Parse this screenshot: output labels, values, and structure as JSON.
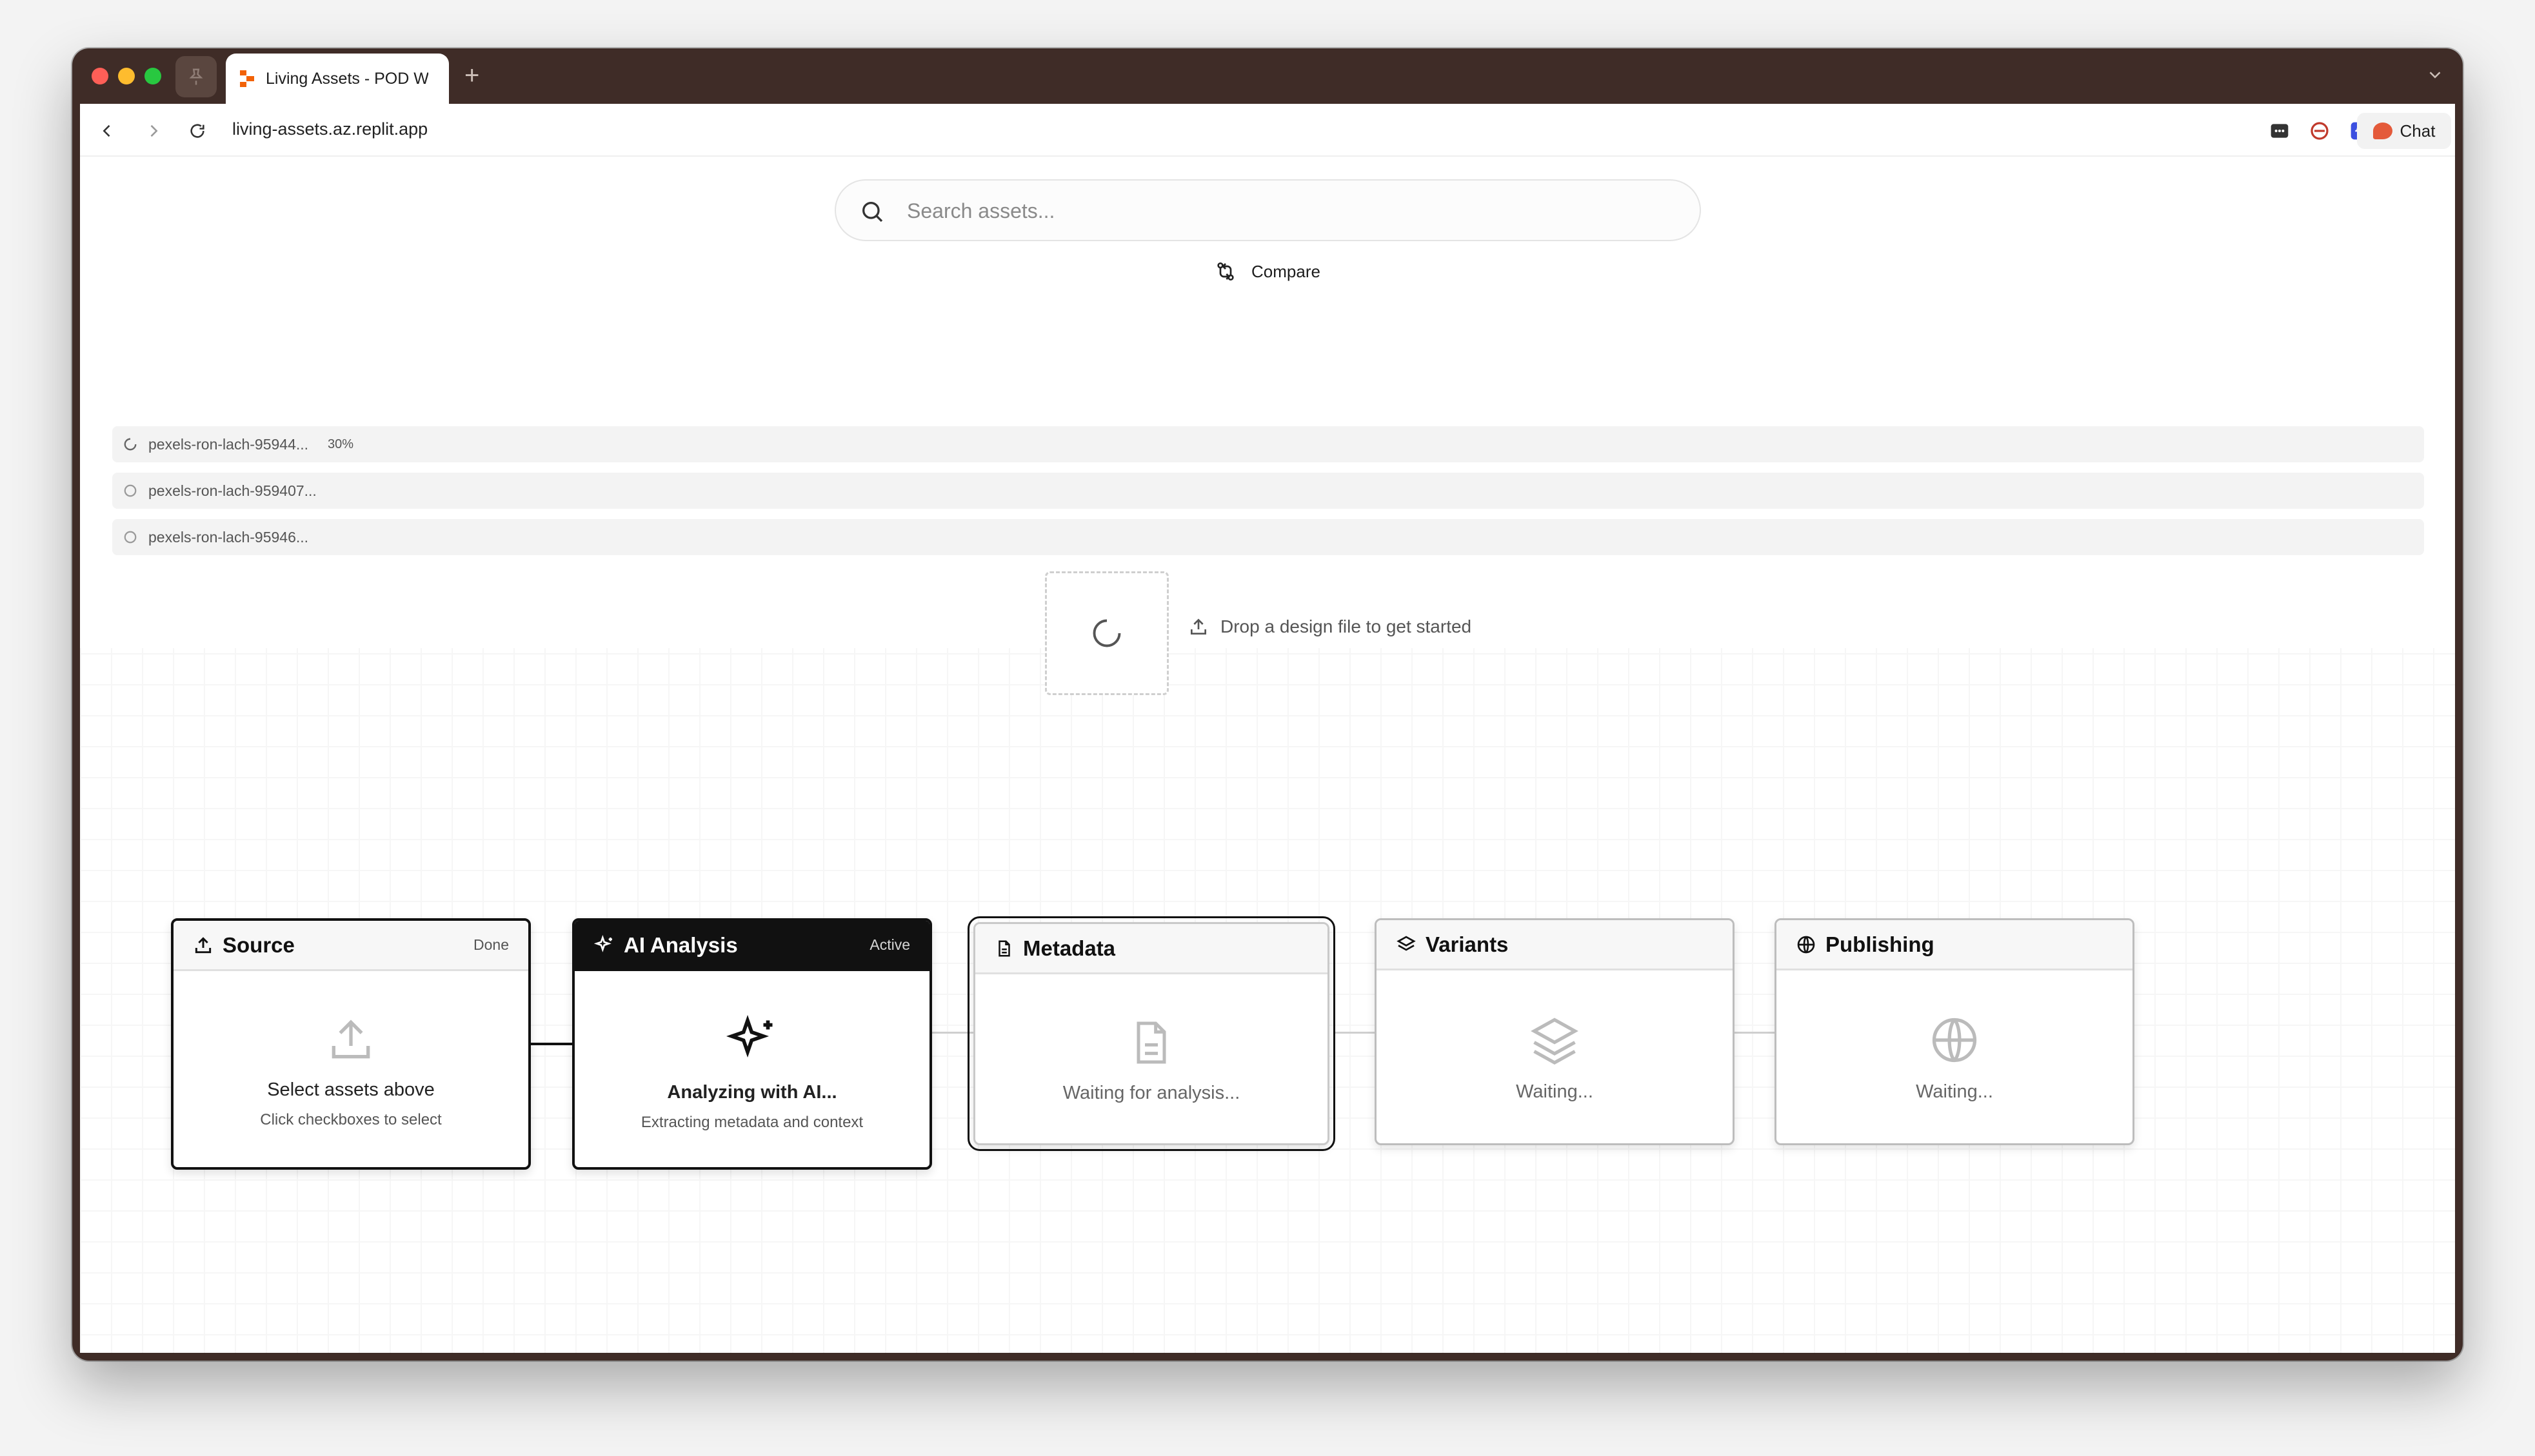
{
  "browser": {
    "tab_title": "Living Assets - POD W",
    "url": "living-assets.az.replit.app",
    "chat_label": "Chat"
  },
  "search": {
    "placeholder": "Search assets..."
  },
  "compare_label": "Compare",
  "uploads": [
    {
      "name": "pexels-ron-lach-95944...",
      "progress": "30%"
    },
    {
      "name": "pexels-ron-lach-959407..."
    },
    {
      "name": "pexels-ron-lach-95946..."
    }
  ],
  "drop_hint": "Drop a design file to get started",
  "pipeline": {
    "source": {
      "title": "Source",
      "badge": "Done",
      "message": "Select assets above",
      "sub": "Click checkboxes to select"
    },
    "ai": {
      "title": "AI Analysis",
      "badge": "Active",
      "message": "Analyzing with AI...",
      "sub": "Extracting metadata and context"
    },
    "metadata": {
      "title": "Metadata",
      "message": "Waiting for analysis..."
    },
    "variants": {
      "title": "Variants",
      "message": "Waiting..."
    },
    "publishing": {
      "title": "Publishing",
      "message": "Waiting..."
    }
  },
  "colors": {
    "brand": "#e45a3a",
    "active_node": "#111111",
    "chrome": "#3f2c27"
  }
}
